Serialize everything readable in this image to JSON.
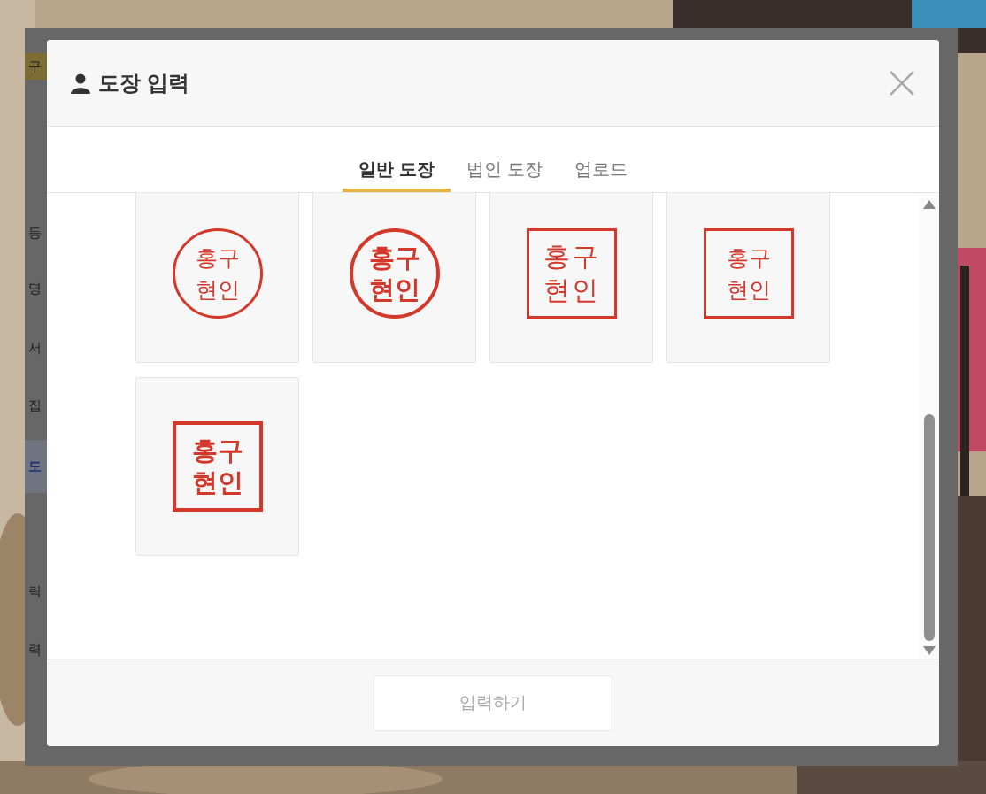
{
  "app": {
    "header": {
      "text": "구"
    },
    "sidebar": [
      {
        "text": "등",
        "selected": false
      },
      {
        "text": "명",
        "selected": false
      },
      {
        "text": "서",
        "selected": false
      },
      {
        "text": "집",
        "selected": false
      },
      {
        "text": "도",
        "selected": true
      },
      {
        "text": "릭",
        "selected": false
      },
      {
        "text": "력",
        "selected": false
      }
    ]
  },
  "dialog": {
    "title": "도장 입력",
    "tabs": [
      {
        "label": "일반 도장",
        "selected": true
      },
      {
        "label": "법인 도장",
        "selected": false
      },
      {
        "label": "업로드",
        "selected": false
      }
    ],
    "stamps": [
      {
        "kind": "circle",
        "lines": [
          "홍구",
          "현인"
        ]
      },
      {
        "kind": "circlebold",
        "lines": [
          "홍구",
          "현인"
        ]
      },
      {
        "kind": "seal",
        "lines": [
          "홍구",
          "현인"
        ]
      },
      {
        "kind": "square",
        "lines": [
          "홍구",
          "현인"
        ]
      },
      {
        "kind": "squarebold",
        "lines": [
          "홍구",
          "현인"
        ]
      }
    ],
    "submit_button": {
      "label": "입력하기",
      "disabled": true
    }
  }
}
